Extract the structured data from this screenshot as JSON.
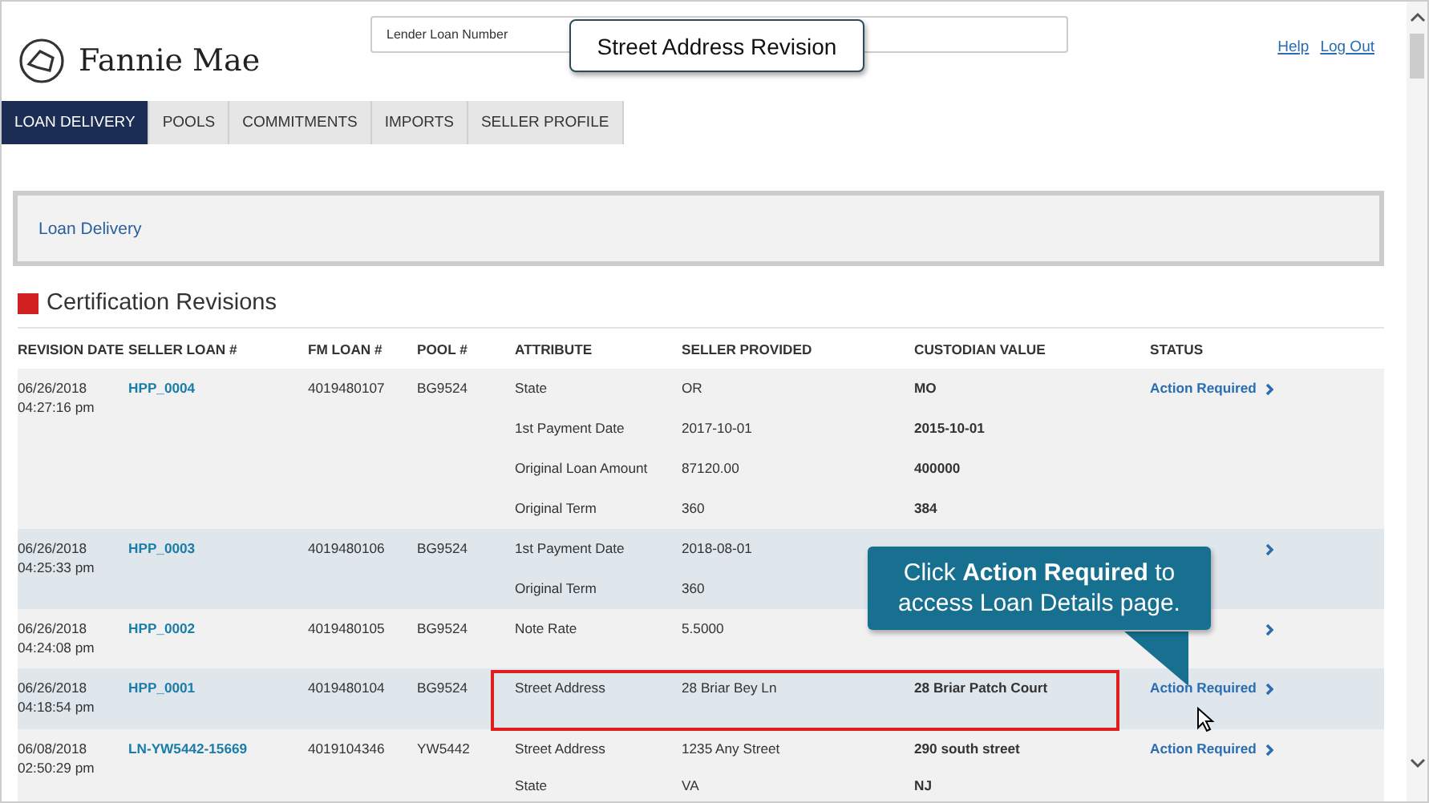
{
  "header": {
    "logo_text": "Fannie Mae",
    "search": {
      "placeholder": "Lender Loan Number"
    },
    "links": [
      "Help",
      "Log Out"
    ]
  },
  "tabs": [
    {
      "label": "LOAN DELIVERY",
      "selected": true
    },
    {
      "label": "POOLS",
      "selected": false
    },
    {
      "label": "COMMITMENTS",
      "selected": false
    },
    {
      "label": "IMPORTS",
      "selected": false
    },
    {
      "label": "SELLER PROFILE",
      "selected": false
    }
  ],
  "breadcrumb": "Loan Delivery",
  "section_title": "Certification Revisions",
  "table": {
    "columns": [
      "REVISION DATE",
      "SELLER LOAN #",
      "FM LOAN #",
      "POOL #",
      "ATTRIBUTE",
      "SELLER PROVIDED",
      "CUSTODIAN VALUE",
      "STATUS"
    ],
    "rows": [
      {
        "date": "06/26/2018",
        "time": "04:27:16 pm",
        "seller_loan": "HPP_0004",
        "fm_loan": "4019480107",
        "pool": "BG9524",
        "status": "Action Required",
        "lines": [
          {
            "attribute": "State",
            "seller_provided": "OR",
            "custodian_value": "MO"
          },
          {
            "attribute": "1st Payment Date",
            "seller_provided": "2017-10-01",
            "custodian_value": "2015-10-01"
          },
          {
            "attribute": "Original Loan Amount",
            "seller_provided": "87120.00",
            "custodian_value": "400000"
          },
          {
            "attribute": "Original Term",
            "seller_provided": "360",
            "custodian_value": "384"
          }
        ]
      },
      {
        "date": "06/26/2018",
        "time": "04:25:33 pm",
        "seller_loan": "HPP_0003",
        "fm_loan": "4019480106",
        "pool": "BG9524",
        "lines": [
          {
            "attribute": "1st Payment Date",
            "seller_provided": "2018-08-01"
          },
          {
            "attribute": "Original Term",
            "seller_provided": "360"
          }
        ]
      },
      {
        "date": "06/26/2018",
        "time": "04:24:08 pm",
        "seller_loan": "HPP_0002",
        "fm_loan": "4019480105",
        "pool": "BG9524",
        "lines": [
          {
            "attribute": "Note Rate",
            "seller_provided": "5.5000"
          }
        ]
      },
      {
        "date": "06/26/2018",
        "time": "04:18:54 pm",
        "seller_loan": "HPP_0001",
        "fm_loan": "4019480104",
        "pool": "BG9524",
        "status": "Action Required",
        "lines": [
          {
            "attribute": "Street Address",
            "seller_provided": "28 Briar Bey Ln",
            "custodian_value": "28 Briar Patch Court"
          }
        ]
      },
      {
        "date": "06/08/2018",
        "time": "02:50:29 pm",
        "seller_loan": "LN-YW5442-15669",
        "fm_loan": "4019104346",
        "pool": "YW5442",
        "status": "Action Required",
        "lines": [
          {
            "attribute": "Street Address",
            "seller_provided": "1235 Any Street",
            "custodian_value": "290 south street"
          },
          {
            "attribute": "State",
            "seller_provided": "VA",
            "custodian_value": "NJ"
          }
        ]
      }
    ]
  },
  "title_callout": "Street Address Revision",
  "hint_callout": "Click **Action Required** to access Loan Details page."
}
